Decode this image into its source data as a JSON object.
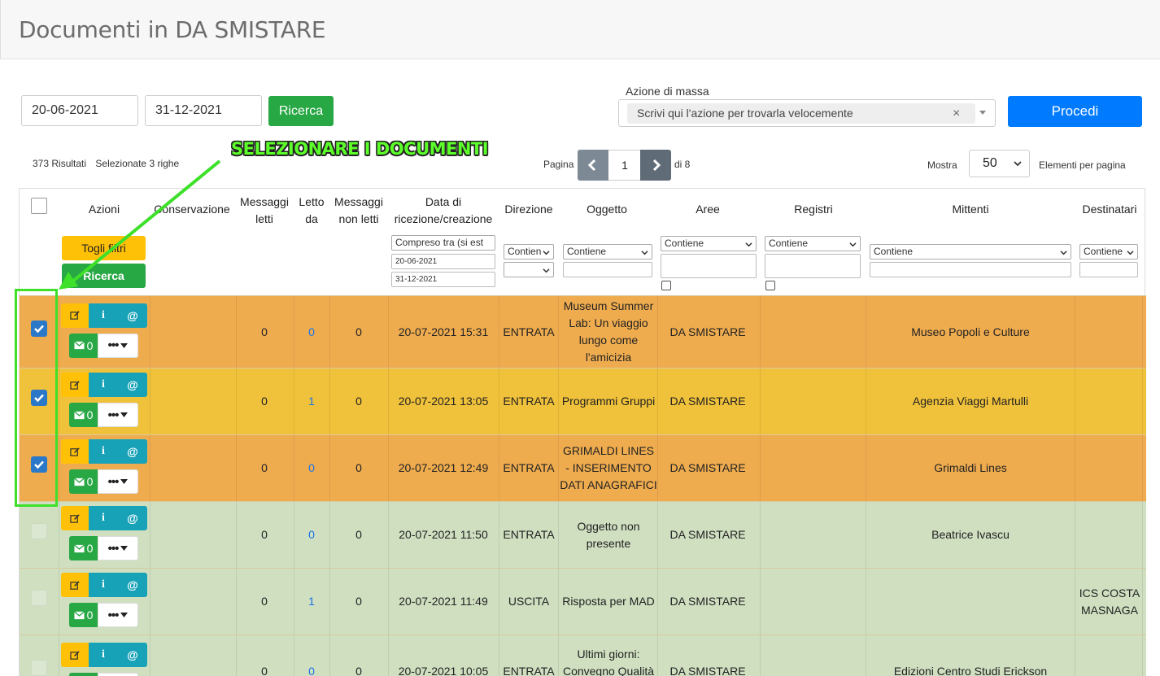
{
  "header": {
    "title": "Documenti in DA SMISTARE"
  },
  "filters": {
    "date_from": "20-06-2021",
    "date_to": "31-12-2021",
    "search_label": "Ricerca",
    "mass_action_label": "Azione di massa",
    "mass_action_placeholder": "Scrivi qui l'azione per trovarla velocemente",
    "mass_action_clear": "×",
    "proceed_label": "Procedi"
  },
  "summary": {
    "results": "373 Risultati",
    "selected": "Selezionate 3 righe"
  },
  "annotation": {
    "text": "SELEZIONARE I DOCUMENTI",
    "color": "#3ee02a"
  },
  "pagination": {
    "label": "Pagina",
    "current": "1",
    "total": "di 8"
  },
  "page_size": {
    "label": "Mostra",
    "value": "50",
    "suffix": "Elementi per pagina"
  },
  "columns": {
    "azioni": "Azioni",
    "conservazione": "Conservazione",
    "msg_letti": "Messaggi letti",
    "letto_da": "Letto da",
    "msg_non_letti": "Messaggi non letti",
    "data": "Data di ricezione/creazione",
    "direzione": "Direzione",
    "oggetto": "Oggetto",
    "aree": "Aree",
    "registri": "Registri",
    "mittenti": "Mittenti",
    "destinatari": "Destinatari"
  },
  "column_filters": {
    "togli_filtri": "Togli filtri",
    "ricerca": "Ricerca",
    "data_mode": "Compreso tra (si est",
    "data_from": "20-06-2021",
    "data_to": "31-12-2021",
    "contiene": "Contiene",
    "contien": "Contien"
  },
  "colors": {
    "row_orange": "#efac4f",
    "row_yellow": "#f0c13a",
    "row_green": "#cfdfc0",
    "edit_btn": "#ffc107",
    "info_btn": "#17a2b8",
    "mail_btn": "#28a745",
    "primary": "#007bff",
    "link": "#1a73e8"
  },
  "rows": [
    {
      "checked": true,
      "color": "orange",
      "mail_count": "0",
      "msg_letti": "0",
      "letto_da": "0",
      "msg_non_letti": "0",
      "data": "20-07-2021 15:31",
      "direzione": "ENTRATA",
      "oggetto": "Museum Summer Lab: Un viaggio lungo come l'amicizia",
      "aree": "DA SMISTARE",
      "registri": "",
      "mittenti": "Museo Popoli e Culture",
      "destinatari": ""
    },
    {
      "checked": true,
      "color": "yellow",
      "mail_count": "0",
      "msg_letti": "0",
      "letto_da": "1",
      "msg_non_letti": "0",
      "data": "20-07-2021 13:05",
      "direzione": "ENTRATA",
      "oggetto": "Programmi Gruppi",
      "aree": "DA SMISTARE",
      "registri": "",
      "mittenti": "Agenzia Viaggi Martulli",
      "destinatari": ""
    },
    {
      "checked": true,
      "color": "orange",
      "mail_count": "0",
      "msg_letti": "0",
      "letto_da": "0",
      "msg_non_letti": "0",
      "data": "20-07-2021 12:49",
      "direzione": "ENTRATA",
      "oggetto": "GRIMALDI LINES - INSERIMENTO DATI ANAGRAFICI",
      "aree": "DA SMISTARE",
      "registri": "",
      "mittenti": "Grimaldi Lines",
      "destinatari": ""
    },
    {
      "checked": false,
      "color": "green",
      "mail_count": "0",
      "msg_letti": "0",
      "letto_da": "0",
      "msg_non_letti": "0",
      "data": "20-07-2021 11:50",
      "direzione": "ENTRATA",
      "oggetto": "Oggetto non presente",
      "aree": "DA SMISTARE",
      "registri": "",
      "mittenti": "Beatrice Ivascu",
      "destinatari": ""
    },
    {
      "checked": false,
      "color": "green",
      "mail_count": "0",
      "msg_letti": "0",
      "letto_da": "1",
      "msg_non_letti": "0",
      "data": "20-07-2021 11:49",
      "direzione": "USCITA",
      "oggetto": "Risposta per MAD",
      "aree": "DA SMISTARE",
      "registri": "",
      "mittenti": "",
      "destinatari": "ICS COSTA MASNAGA"
    },
    {
      "checked": false,
      "color": "green",
      "mail_count": "0",
      "msg_letti": "0",
      "letto_da": "0",
      "msg_non_letti": "0",
      "data": "20-07-2021 10:05",
      "direzione": "ENTRATA",
      "oggetto": "Ultimi giorni: Convegno Qualità e Sfi",
      "aree": "DA SMISTARE",
      "registri": "",
      "mittenti": "Edizioni Centro Studi Erickson",
      "destinatari": ""
    }
  ]
}
